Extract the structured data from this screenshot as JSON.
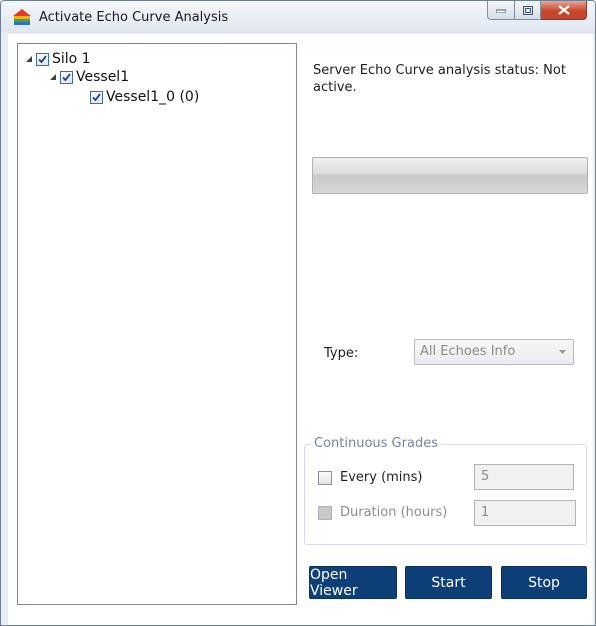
{
  "window": {
    "title": "Activate Echo Curve Analysis",
    "icon": "rainbow-house-icon"
  },
  "tree": {
    "items": [
      {
        "label": "Silo 1",
        "expanded": true,
        "checked": true,
        "level": 0
      },
      {
        "label": "Vessel1",
        "expanded": true,
        "checked": true,
        "level": 1
      },
      {
        "label": "Vessel1_0 (0)",
        "checked": true,
        "level": 2
      }
    ]
  },
  "status": {
    "text": "Server Echo Curve analysis status: Not active."
  },
  "progress": {
    "value": 0
  },
  "type": {
    "label": "Type:",
    "selected": "All Echoes Info"
  },
  "continuous_grades": {
    "header": "Continuous Grades",
    "every": {
      "label": "Every (mins)",
      "value": "5",
      "checked": false
    },
    "duration": {
      "label": "Duration (hours)",
      "value": "1",
      "checked": false,
      "disabled": true
    }
  },
  "buttons": {
    "open_viewer": "Open Viewer",
    "start": "Start",
    "stop": "Stop"
  },
  "colors": {
    "button_bg": "#0f3f78",
    "group_header": "#7186a4",
    "close_button": "#c7472e"
  }
}
